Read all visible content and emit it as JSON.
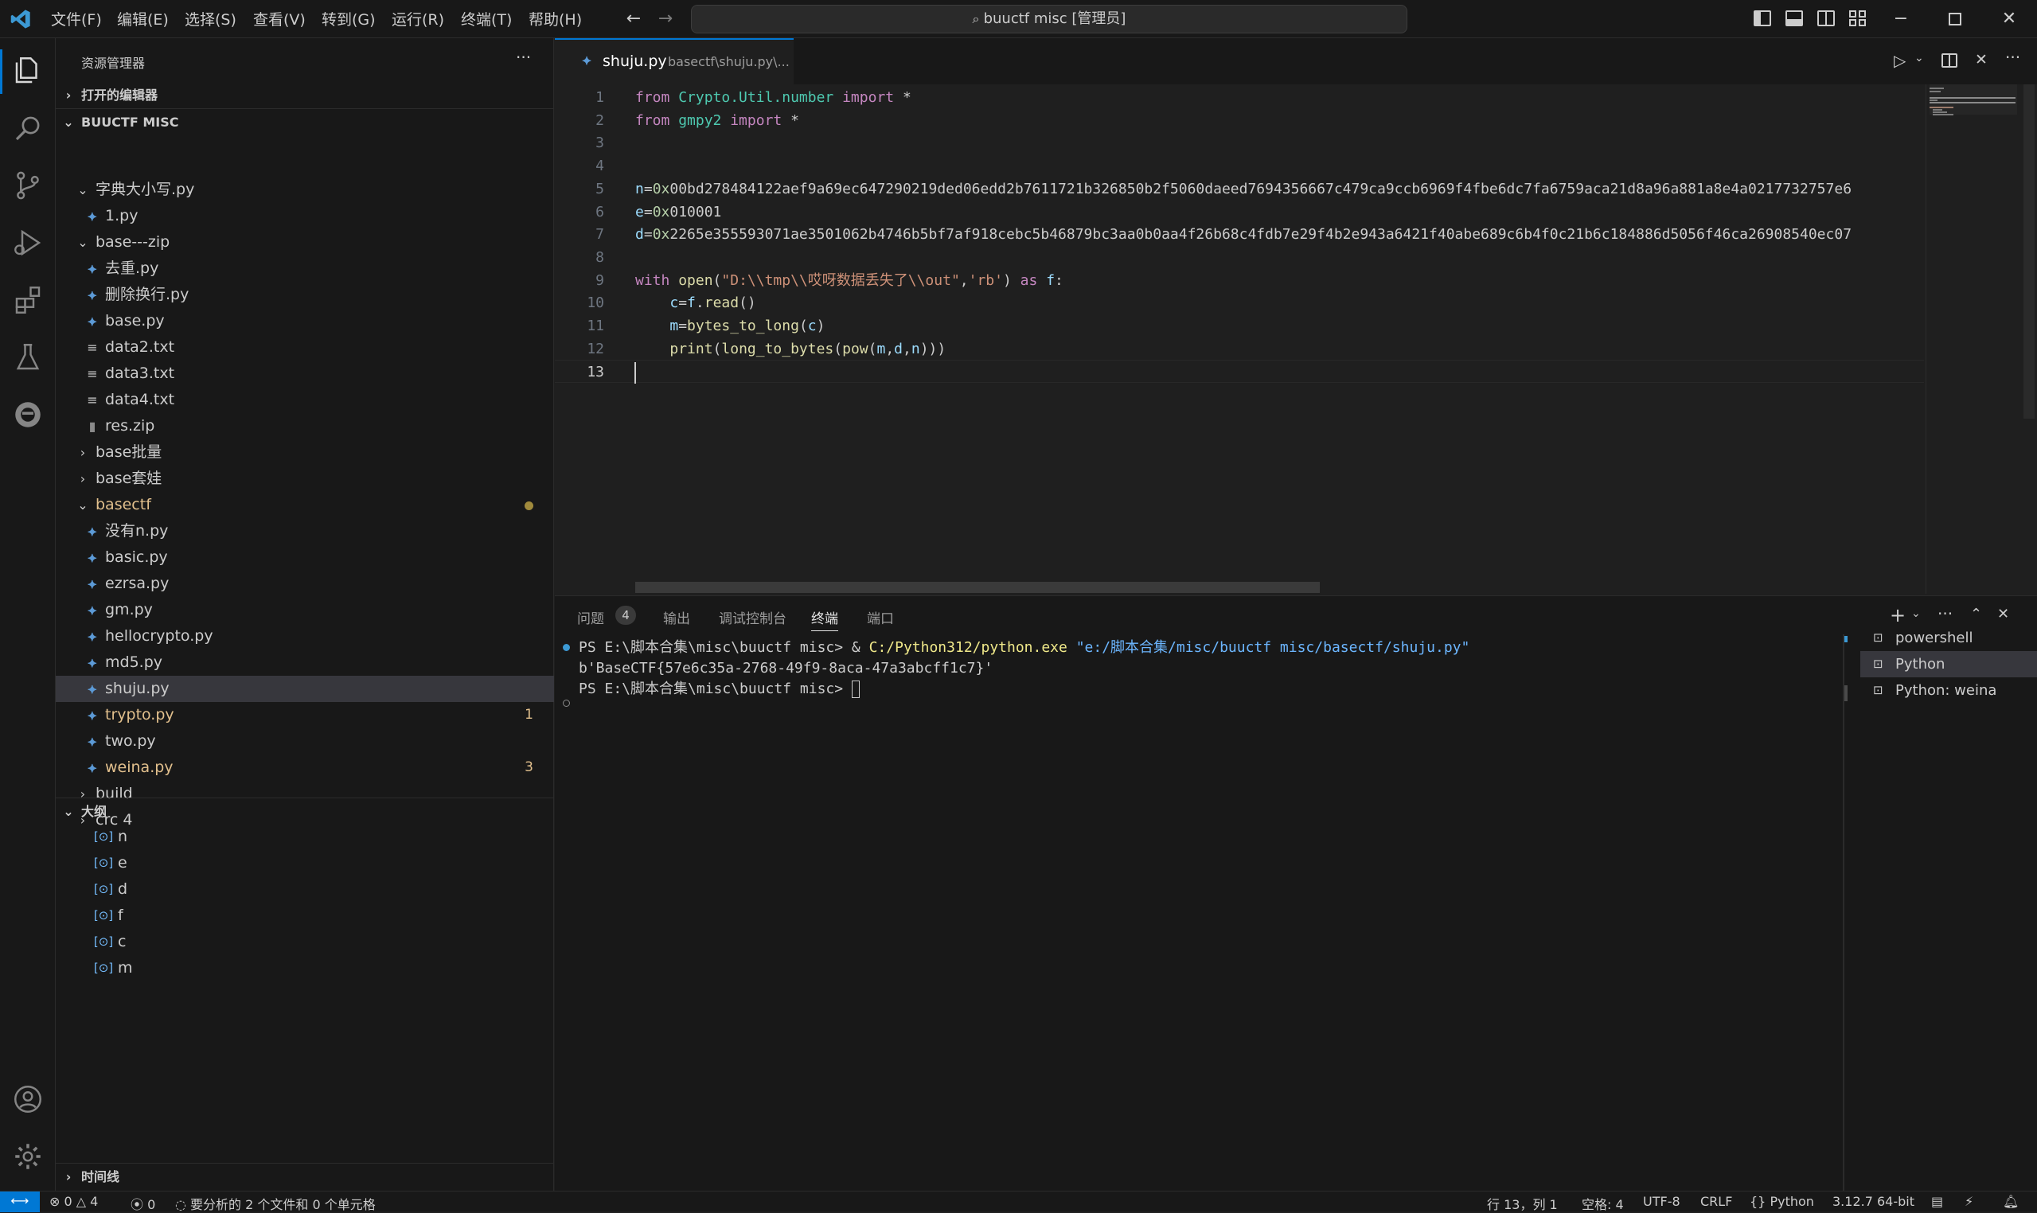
{
  "titlebar": {
    "menus": [
      "文件(F)",
      "编辑(E)",
      "选择(S)",
      "查看(V)",
      "转到(G)",
      "运行(R)",
      "终端(T)",
      "帮助(H)"
    ],
    "command_center": "buuctf misc [管理员]"
  },
  "sidebar": {
    "title": "资源管理器",
    "open_editors": "打开的编辑器",
    "workspace": "BUUCTF MISC",
    "tree": [
      {
        "label": "字典大小写.py",
        "kind": "folder-open",
        "depth": 1
      },
      {
        "label": "1.py",
        "kind": "py",
        "depth": 2
      },
      {
        "label": "base---zip",
        "kind": "folder-open",
        "depth": 1
      },
      {
        "label": "去重.py",
        "kind": "py",
        "depth": 2
      },
      {
        "label": "删除换行.py",
        "kind": "py",
        "depth": 2
      },
      {
        "label": "base.py",
        "kind": "py",
        "depth": 2
      },
      {
        "label": "data2.txt",
        "kind": "txt",
        "depth": 2
      },
      {
        "label": "data3.txt",
        "kind": "txt",
        "depth": 2
      },
      {
        "label": "data4.txt",
        "kind": "txt",
        "depth": 2
      },
      {
        "label": "res.zip",
        "kind": "zip",
        "depth": 2
      },
      {
        "label": "base批量",
        "kind": "folder",
        "depth": 1
      },
      {
        "label": "base套娃",
        "kind": "folder",
        "depth": 1
      },
      {
        "label": "basectf",
        "kind": "folder-open",
        "depth": 1,
        "modified": true
      },
      {
        "label": "没有n.py",
        "kind": "py",
        "depth": 2
      },
      {
        "label": "basic.py",
        "kind": "py",
        "depth": 2
      },
      {
        "label": "ezrsa.py",
        "kind": "py",
        "depth": 2
      },
      {
        "label": "gm.py",
        "kind": "py",
        "depth": 2
      },
      {
        "label": "hellocrypto.py",
        "kind": "py",
        "depth": 2
      },
      {
        "label": "md5.py",
        "kind": "py",
        "depth": 2
      },
      {
        "label": "shuju.py",
        "kind": "py",
        "depth": 2,
        "selected": true
      },
      {
        "label": "trypto.py",
        "kind": "py",
        "depth": 2,
        "modified": true,
        "badge": "1"
      },
      {
        "label": "two.py",
        "kind": "py",
        "depth": 2
      },
      {
        "label": "weina.py",
        "kind": "py",
        "depth": 2,
        "modified": true,
        "badge": "3"
      },
      {
        "label": "build",
        "kind": "folder",
        "depth": 1
      },
      {
        "label": "crc 4",
        "kind": "folder",
        "depth": 1
      }
    ],
    "outline_title": "大纲",
    "outline": [
      "n",
      "e",
      "d",
      "f",
      "c",
      "m"
    ],
    "timeline": "时间线"
  },
  "editor": {
    "tab_name": "shuju.py",
    "tab_path": "basectf\\shuju.py\\...",
    "cursor_line": 13
  },
  "code_lines": [
    [
      [
        "k",
        "from "
      ],
      [
        "m",
        "Crypto.Util.number "
      ],
      [
        "k",
        "import "
      ],
      [
        "",
        "*"
      ]
    ],
    [
      [
        "k",
        "from "
      ],
      [
        "m",
        "gmpy2 "
      ],
      [
        "k",
        "import "
      ],
      [
        "",
        "*"
      ]
    ],
    [],
    [],
    [
      [
        "v",
        "n"
      ],
      [
        "",
        "="
      ],
      [
        "n",
        "0x"
      ],
      [
        "",
        "00bd278484122aef9a69ec647290219ded06edd2b7611721b326850b2f5060daeed7694356667c479ca9ccb6969f4fbe6dc7fa6759aca21d8a96a881a8e4a0217732757e6"
      ]
    ],
    [
      [
        "v",
        "e"
      ],
      [
        "",
        "="
      ],
      [
        "n",
        "0x"
      ],
      [
        "",
        "010001"
      ]
    ],
    [
      [
        "v",
        "d"
      ],
      [
        "",
        "="
      ],
      [
        "n",
        "0x"
      ],
      [
        "",
        "2265e355593071ae3501062b4746b5bf7af918cebc5b46879bc3aa0b0aa4f26b68c4fdb7e29f4b2e943a6421f40abe689c6b4f0c21b6c184886d5056f46ca26908540ec07"
      ]
    ],
    [],
    [
      [
        "k",
        "with "
      ],
      [
        "f",
        "open"
      ],
      [
        "",
        "("
      ],
      [
        "s",
        "\"D:\\\\tmp\\\\哎呀数据丢失了\\\\out\""
      ],
      [
        "",
        ","
      ],
      [
        "s",
        "'rb'"
      ],
      [
        "",
        ") "
      ],
      [
        "k",
        "as "
      ],
      [
        "v",
        "f"
      ],
      [
        "",
        ":"
      ]
    ],
    [
      [
        "",
        "    "
      ],
      [
        "v",
        "c"
      ],
      [
        "",
        "="
      ],
      [
        "v",
        "f"
      ],
      [
        "",
        "."
      ],
      [
        "f",
        "read"
      ],
      [
        "",
        "()"
      ]
    ],
    [
      [
        "",
        "    "
      ],
      [
        "v",
        "m"
      ],
      [
        "",
        "="
      ],
      [
        "f",
        "bytes_to_long"
      ],
      [
        "",
        "("
      ],
      [
        "v",
        "c"
      ],
      [
        "",
        ")"
      ]
    ],
    [
      [
        "",
        "    "
      ],
      [
        "f",
        "print"
      ],
      [
        "",
        "("
      ],
      [
        "f",
        "long_to_bytes"
      ],
      [
        "",
        "("
      ],
      [
        "f",
        "pow"
      ],
      [
        "",
        "("
      ],
      [
        "v",
        "m"
      ],
      [
        "",
        ","
      ],
      [
        "v",
        "d"
      ],
      [
        "",
        ","
      ],
      [
        "v",
        "n"
      ],
      [
        "",
        ")))"
      ]
    ],
    []
  ],
  "panel": {
    "tabs": [
      "问题",
      "输出",
      "调试控制台",
      "终端",
      "端口"
    ],
    "problems_count": "4",
    "active_tab": "终端",
    "terminal": {
      "line1_prompt": "PS E:\\脚本合集\\misc\\buuctf misc> & ",
      "line1_exe": "C:/Python312/python.exe",
      "line1_arg": " \"e:/脚本合集/misc/buuctf misc/basectf/shuju.py\"",
      "line2": "b'BaseCTF{57e6c35a-2768-49f9-8aca-47a3abcff1c7}'",
      "line3": "PS E:\\脚本合集\\misc\\buuctf misc> "
    },
    "terminals": [
      "powershell",
      "Python",
      "Python: weina"
    ],
    "selected_terminal": "Python"
  },
  "statusbar": {
    "errors": "0",
    "warnings": "4",
    "ports": "0",
    "analysis": "要分析的 2 个文件和 0 个单元格",
    "position": "行 13，列 1",
    "spaces": "空格: 4",
    "encoding": "UTF-8",
    "eol": "CRLF",
    "language": "Python",
    "interpreter": "3.12.7 64-bit"
  },
  "colors": {
    "accent": "#0078d4",
    "modified": "#e2c08d",
    "remote": "#0078d4"
  }
}
